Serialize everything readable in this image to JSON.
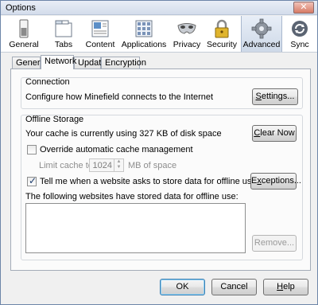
{
  "window": {
    "title": "Options",
    "close_glyph": "✕"
  },
  "toolbar": {
    "panes": [
      {
        "label": "General",
        "icon": "switch-icon"
      },
      {
        "label": "Tabs",
        "icon": "tabs-icon"
      },
      {
        "label": "Content",
        "icon": "content-icon"
      },
      {
        "label": "Applications",
        "icon": "applications-icon"
      },
      {
        "label": "Privacy",
        "icon": "mask-icon"
      },
      {
        "label": "Security",
        "icon": "padlock-icon"
      },
      {
        "label": "Advanced",
        "icon": "gear-icon",
        "selected": true
      },
      {
        "label": "Sync",
        "icon": "sync-icon"
      }
    ]
  },
  "tabs": [
    {
      "label": "General"
    },
    {
      "label": "Network",
      "active": true
    },
    {
      "label": "Update"
    },
    {
      "label": "Encryption"
    }
  ],
  "connection": {
    "title": "Connection",
    "description": "Configure how Minefield connects to the Internet",
    "settings_button": "Settings..."
  },
  "offline": {
    "title": "Offline Storage",
    "cache_usage": "Your cache is currently using 327 KB of disk space",
    "clear_now_button": "Clear Now",
    "override_label": "Override automatic cache management",
    "override_checked": false,
    "limit_label": "Limit cache to",
    "limit_value": "1024",
    "limit_unit": "MB of space",
    "tell_me_label": "Tell me when a website asks to store data for offline use",
    "tell_me_checked": true,
    "exceptions_button": "Exceptions...",
    "websites_label": "The following websites have stored data for offline use:",
    "websites": [],
    "remove_button": "Remove..."
  },
  "footer": {
    "ok_button": "OK",
    "cancel_button": "Cancel",
    "help_button": "Help"
  },
  "colors": {
    "selected_pane": "#ced9e8",
    "title_bar": "#d3dceb",
    "close_button": "#d67a65"
  }
}
